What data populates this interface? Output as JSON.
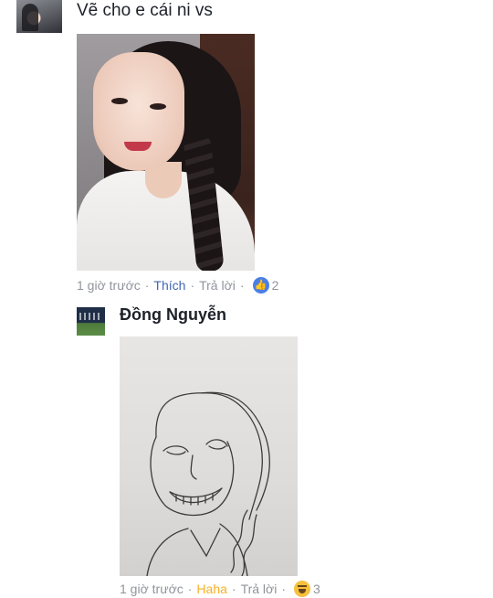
{
  "top_comment": {
    "text": "Vẽ cho e cái ni vs",
    "meta": {
      "time": "1 giờ trước",
      "like": "Thích",
      "reply": "Trả lời",
      "reaction_count": "2"
    }
  },
  "reply": {
    "author": "Đồng Nguyễn",
    "meta": {
      "time": "1 giờ trước",
      "like": "Haha",
      "reply": "Trả lời",
      "reaction_count": "3"
    }
  },
  "icons": {
    "like_reaction": "thumbs-up-icon",
    "haha_reaction": "laughing-face-icon"
  },
  "colors": {
    "text": "#1d2129",
    "meta": "#90949c",
    "like_blue": "#4267b2",
    "haha_yellow": "#f7b125"
  }
}
